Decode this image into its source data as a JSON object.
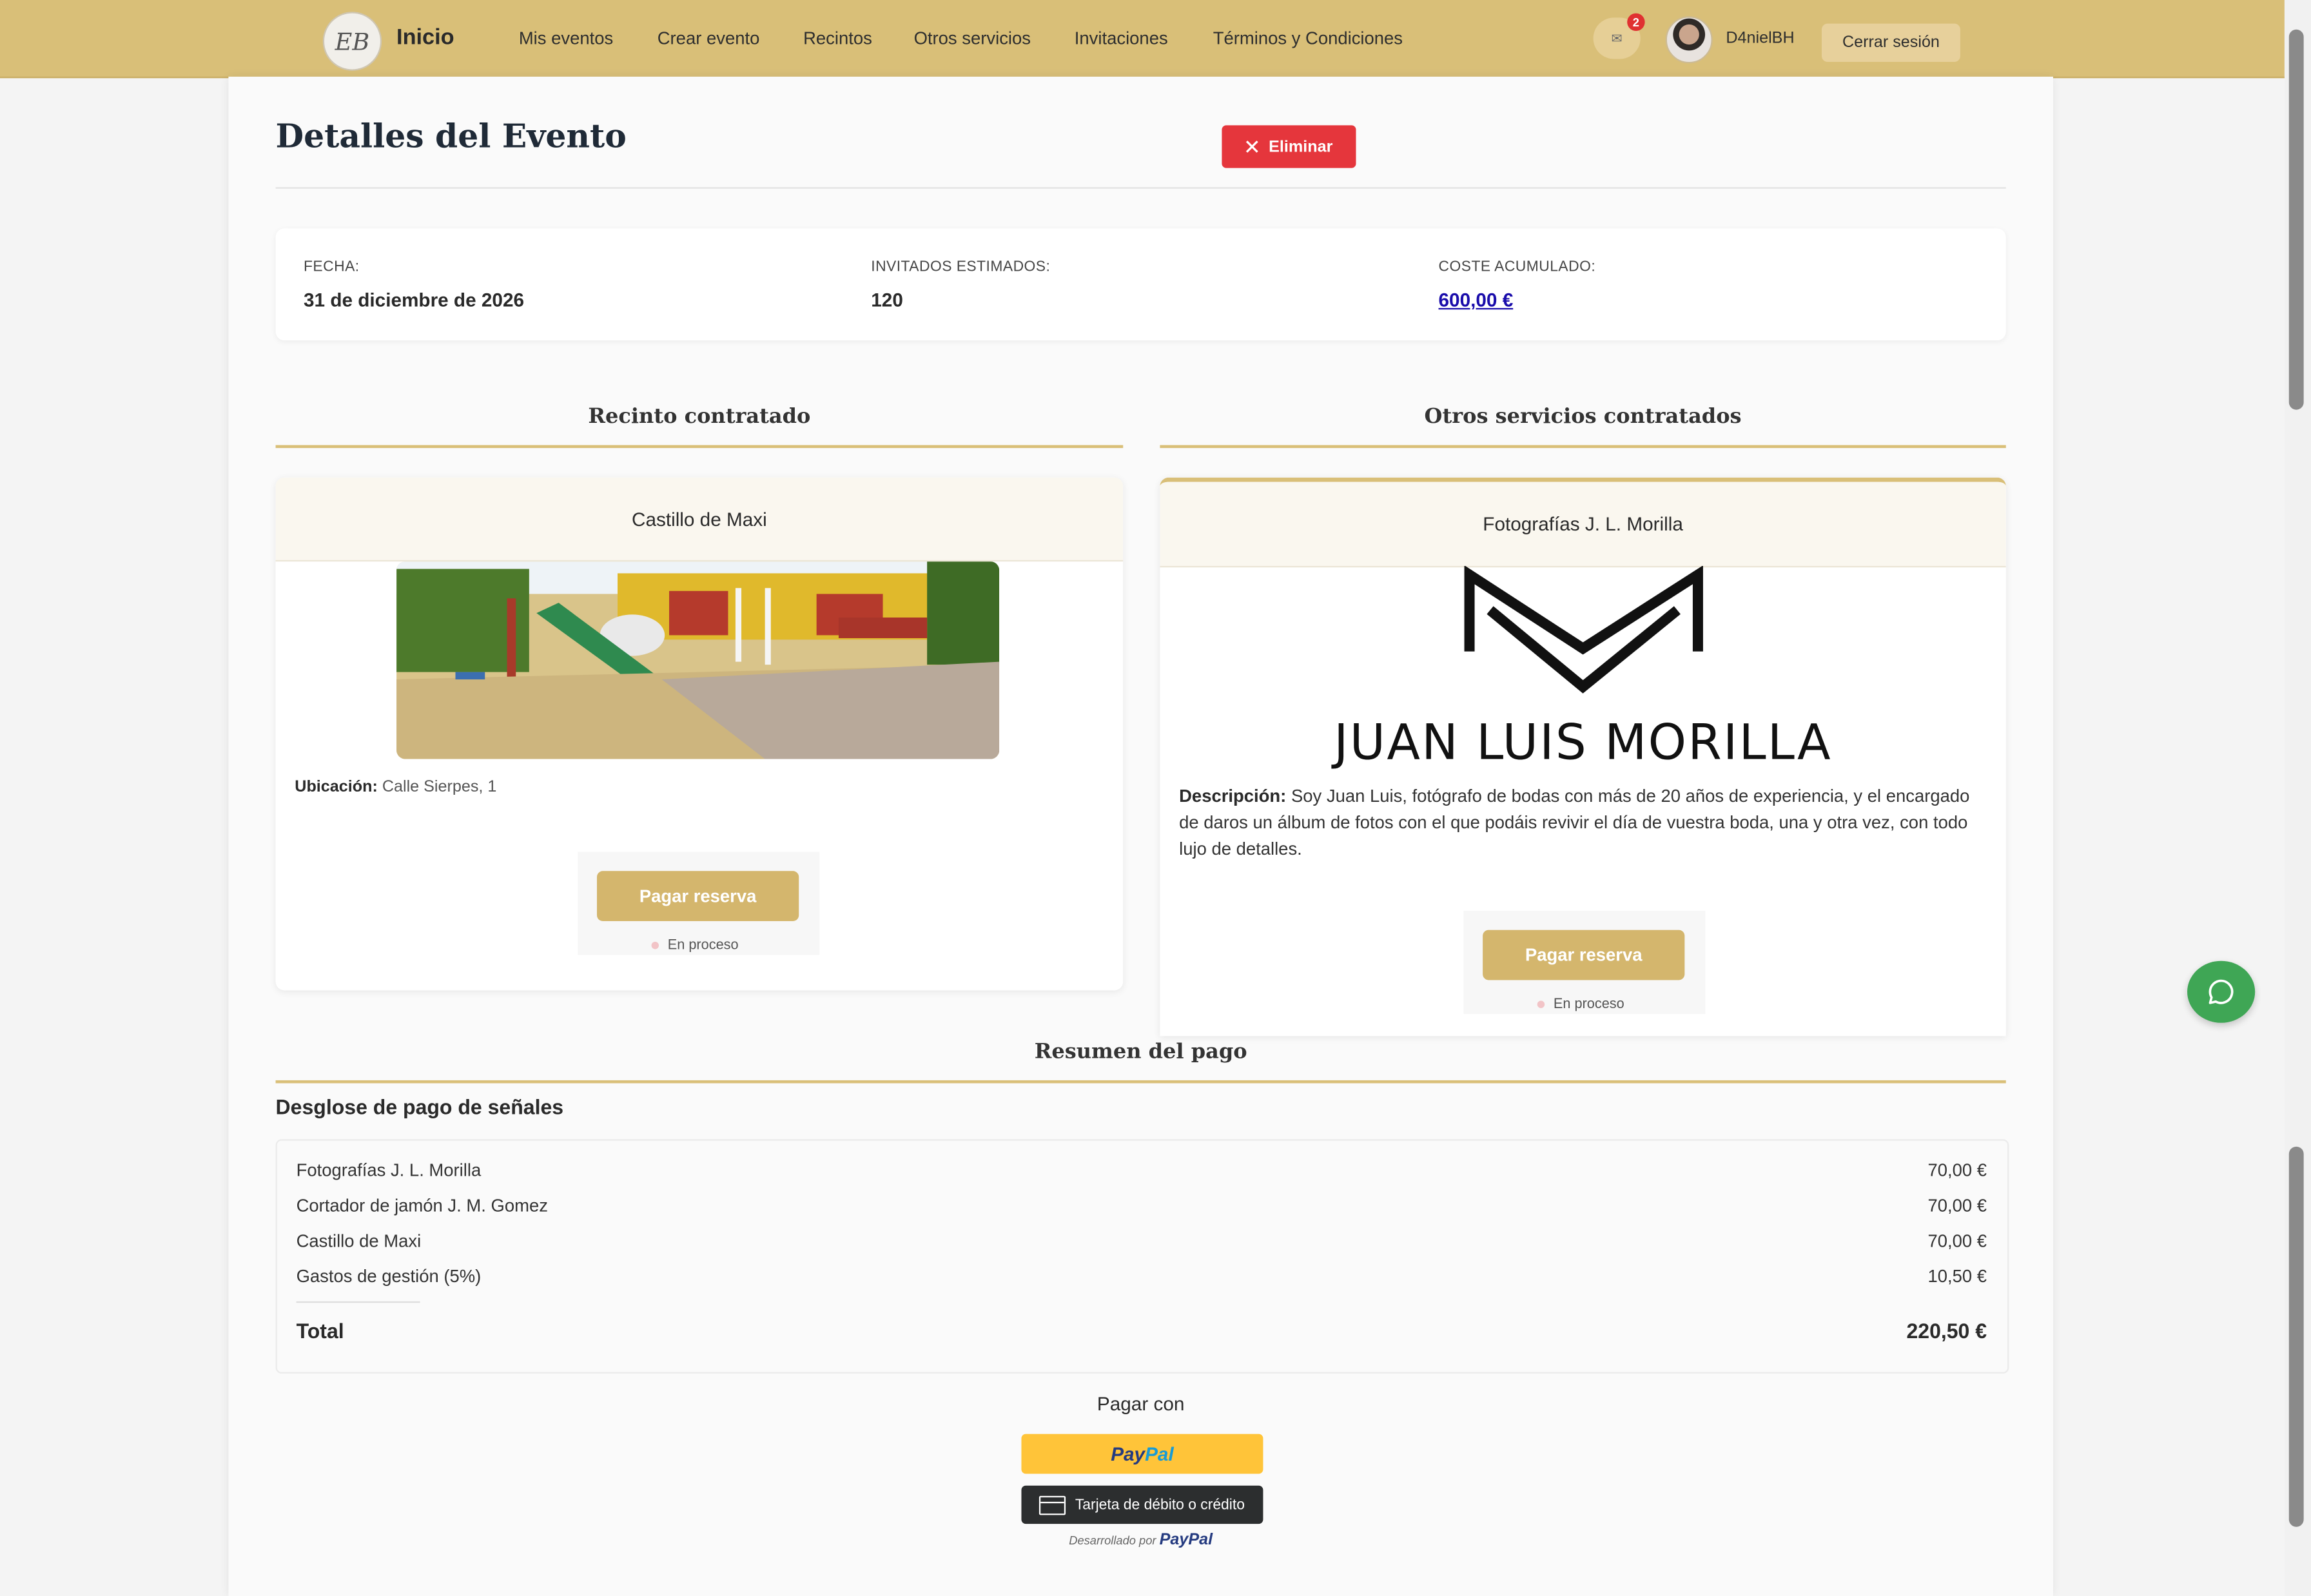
{
  "nav": {
    "logo_text": "EB",
    "brand": "Inicio",
    "items": [
      "Mis eventos",
      "Crear evento",
      "Recintos",
      "Otros servicios",
      "Invitaciones",
      "Términos y Condiciones"
    ],
    "mail_icon": "✉",
    "notification_count": "2",
    "username": "D4nielBH",
    "logout_label": "Cerrar sesión"
  },
  "page": {
    "title": "Detalles del Evento",
    "delete_label": "Eliminar"
  },
  "info": {
    "date_label": "FECHA:",
    "date_value": "31 de diciembre de 2026",
    "guests_label": "INVITADOS ESTIMADOS:",
    "guests_value": "120",
    "cost_label": "COSTE ACUMULADO:",
    "cost_value": "600,00 €"
  },
  "venue_section": {
    "title": "Recinto contratado",
    "card_title": "Castillo de Maxi",
    "location_label": "Ubicación:",
    "location_value": "Calle Sierpes, 1",
    "pay_label": "Pagar reserva",
    "status": "En proceso"
  },
  "services_section": {
    "title": "Otros servicios contratados",
    "card_title": "Fotografías J. L. Morilla",
    "logo_text": "JUAN LUIS MORILLA",
    "description_label": "Descripción:",
    "description": "Soy Juan Luis, fotógrafo de bodas con más de 20 años de experiencia, y el encargado de daros un álbum de fotos con el que podáis revivir el día de vuestra boda, una y otra vez, con todo lujo de detalles.",
    "pay_label": "Pagar reserva",
    "status": "En proceso"
  },
  "summary": {
    "title": "Resumen del pago",
    "subtitle": "Desglose de pago de señales",
    "rows": [
      {
        "label": "Fotografías J. L. Morilla",
        "amount": "70,00 €"
      },
      {
        "label": "Cortador de jamón J. M. Gomez",
        "amount": "70,00 €"
      },
      {
        "label": "Castillo de Maxi",
        "amount": "70,00 €"
      },
      {
        "label": "Gastos de gestión (5%)",
        "amount": "10,50 €"
      }
    ],
    "total_label": "Total",
    "total_amount": "220,50 €"
  },
  "payment": {
    "pay_with": "Pagar con",
    "paypal_part1": "Pay",
    "paypal_part2": "Pal",
    "card_label": "Tarjeta de débito o crédito",
    "powered_prefix": "Desarrollado por",
    "powered_brand": "PayPal"
  },
  "colors": {
    "navbar": "#d9bf78",
    "accent_gold": "#d4b66d",
    "delete_red": "#e5363c",
    "chat_green": "#3fa655",
    "paypal_yellow": "#ffc439"
  }
}
